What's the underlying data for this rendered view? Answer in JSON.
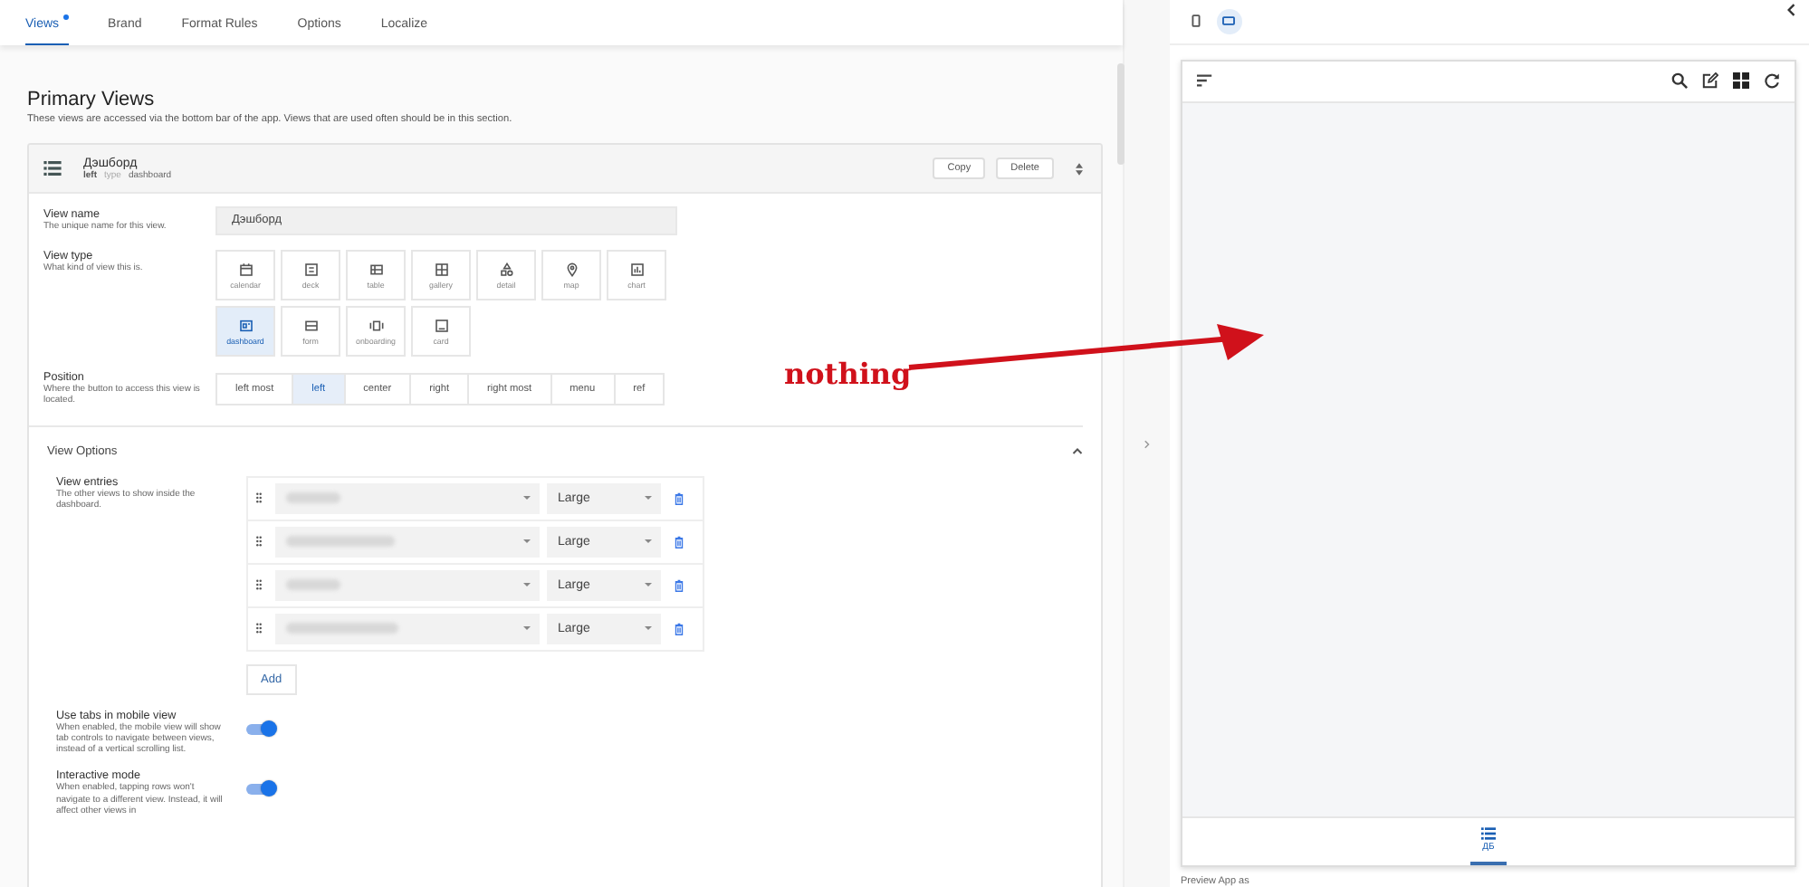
{
  "tabs": [
    {
      "label": "Views",
      "selected": true,
      "modified": true
    },
    {
      "label": "Brand",
      "selected": false,
      "modified": false
    },
    {
      "label": "Format Rules",
      "selected": false,
      "modified": false
    },
    {
      "label": "Options",
      "selected": false,
      "modified": false
    },
    {
      "label": "Localize",
      "selected": false,
      "modified": false
    }
  ],
  "section": {
    "title": "Primary Views",
    "description": "These views are accessed via the bottom bar of the app. Views that are used often should be in this section."
  },
  "view_card": {
    "name": "Дэшборд",
    "position": "left",
    "type_label": "type",
    "type": "dashboard",
    "buttons": [
      "Copy",
      "Delete"
    ]
  },
  "view_name": {
    "label": "View name",
    "hint": "The unique name for this view.",
    "value": "Дэшборд"
  },
  "view_type": {
    "label": "View type",
    "hint": "What kind of view this is.",
    "options": [
      {
        "label": "calendar",
        "kind": "calendar",
        "selected": false
      },
      {
        "label": "deck",
        "kind": "deck",
        "selected": false
      },
      {
        "label": "table",
        "kind": "table",
        "selected": false
      },
      {
        "label": "gallery",
        "kind": "gallery",
        "selected": false
      },
      {
        "label": "detail",
        "kind": "detail",
        "selected": false
      },
      {
        "label": "map",
        "kind": "map",
        "selected": false
      },
      {
        "label": "chart",
        "kind": "chart",
        "selected": false
      },
      {
        "label": "dashboard",
        "kind": "dashboard",
        "selected": true
      },
      {
        "label": "form",
        "kind": "form",
        "selected": false
      },
      {
        "label": "onboarding",
        "kind": "onboarding",
        "selected": false
      },
      {
        "label": "card",
        "kind": "card",
        "selected": false
      }
    ]
  },
  "position": {
    "label": "Position",
    "hint": "Where the button to access this view is located.",
    "options": [
      {
        "label": "left most",
        "selected": false
      },
      {
        "label": "left",
        "selected": true
      },
      {
        "label": "center",
        "selected": false
      },
      {
        "label": "right",
        "selected": false
      },
      {
        "label": "right most",
        "selected": false
      },
      {
        "label": "menu",
        "selected": false
      },
      {
        "label": "ref",
        "selected": false
      }
    ]
  },
  "view_options": {
    "title": "View Options",
    "expanded": true,
    "entries": {
      "label": "View entries",
      "hint": "The other views to show inside the dashboard.",
      "rows": [
        {
          "size": "Large"
        },
        {
          "size": "Large"
        },
        {
          "size": "Large"
        },
        {
          "size": "Large"
        }
      ],
      "add": "Add"
    },
    "toggles": [
      {
        "label": "Use tabs in mobile view",
        "hint": "When enabled, the mobile view will show tab controls to navigate between views, instead of a vertical scrolling list.",
        "on": true
      },
      {
        "label": "Interactive mode",
        "hint": "When enabled, tapping rows won't navigate to a different view. Instead, it will affect other views in",
        "on": true
      }
    ]
  },
  "preview": {
    "devices": [
      {
        "kind": "phone",
        "selected": false
      },
      {
        "kind": "tablet",
        "selected": true
      }
    ],
    "nav": [
      {
        "label": "ДБ",
        "selected": true
      }
    ],
    "footer": "Preview App as"
  },
  "annotation": {
    "text": "nothing"
  }
}
